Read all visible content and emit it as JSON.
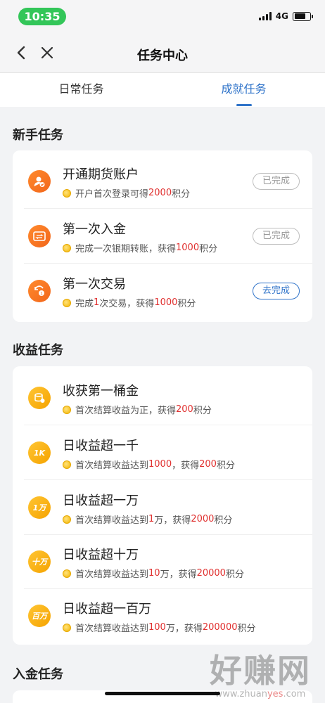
{
  "status_bar": {
    "time": "10:35",
    "network": "4G"
  },
  "nav": {
    "title": "任务中心",
    "back_icon": "chevron-left-icon",
    "close_icon": "close-icon"
  },
  "tabs": [
    {
      "label": "日常任务",
      "active": false
    },
    {
      "label": "成就任务",
      "active": true
    }
  ],
  "sections": [
    {
      "title": "新手任务",
      "items": [
        {
          "icon": "user-check-icon",
          "title": "开通期货账户",
          "desc_before": "开户首次登录可得 ",
          "desc_value": "2000",
          "desc_after": " 积分",
          "status": "已完成"
        },
        {
          "icon": "card-transfer-icon",
          "title": "第一次入金",
          "desc_before": "完成一次银期转账，获得 ",
          "desc_value": "1000",
          "desc_after": " 积分",
          "status": "已完成"
        },
        {
          "icon": "trade-exchange-icon",
          "title": "第一次交易",
          "desc_before": "完成 ",
          "desc_value": "1",
          "desc_middle": " 次交易，获得 ",
          "desc_value2": "1000",
          "desc_after": " 积分",
          "status": "去完成"
        }
      ]
    },
    {
      "title": "收益任务",
      "items": [
        {
          "icon": "gold-bucket-icon",
          "title": "收获第一桶金",
          "desc_before": "首次结算收益为正，获得 ",
          "desc_value": "200",
          "desc_after": " 积分"
        },
        {
          "icon": "badge-1k-icon",
          "badge_text": "1K",
          "title": "日收益超一千",
          "desc_before": "首次结算收益达到 ",
          "desc_value": "1000",
          "desc_middle": " ，获得 ",
          "desc_value2": "200",
          "desc_after": " 积分"
        },
        {
          "icon": "badge-1wan-icon",
          "badge_text": "1万",
          "title": "日收益超一万",
          "desc_before": "首次结算收益达到 ",
          "desc_value": "1",
          "desc_middle": " 万，获得 ",
          "desc_value2": "2000",
          "desc_after": " 积分"
        },
        {
          "icon": "badge-10wan-icon",
          "badge_text": "十万",
          "title": "日收益超十万",
          "desc_before": "首次结算收益达到 ",
          "desc_value": "10",
          "desc_middle": " 万，获得 ",
          "desc_value2": "20000",
          "desc_after": " 积分"
        },
        {
          "icon": "badge-100wan-icon",
          "badge_text": "百万",
          "title": "日收益超一百万",
          "desc_before": "首次结算收益达到 ",
          "desc_value": "100",
          "desc_middle": " 万，获得 ",
          "desc_value2": "200000",
          "desc_after": " 积分"
        }
      ]
    },
    {
      "title": "入金任务"
    }
  ],
  "watermark": {
    "big": "好赚网",
    "small_a": "www.zhuan",
    "small_b": "yes",
    "small_c": ".com"
  },
  "colors": {
    "accent": "#2f73c9",
    "highlight": "#e0302f",
    "orange": "#f2661b",
    "gold": "#f5a300"
  }
}
